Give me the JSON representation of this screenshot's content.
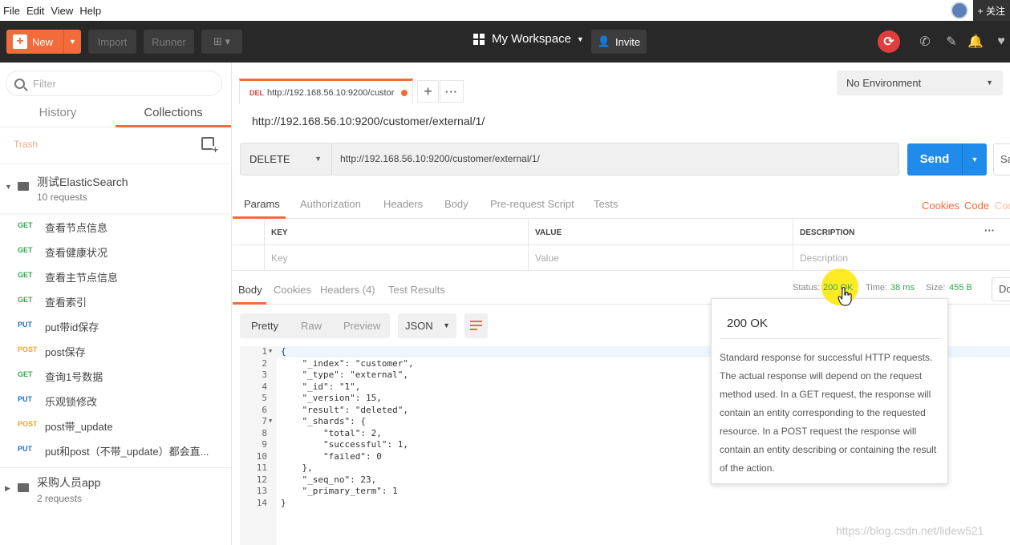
{
  "menubar": {
    "items": [
      "File",
      "Edit",
      "View",
      "Help"
    ],
    "follow_label": "+ 关注"
  },
  "header": {
    "new_label": "New",
    "import_label": "Import",
    "runner_label": "Runner",
    "workspace_label": "My Workspace",
    "invite_label": "Invite",
    "accent_color": "#f26b3a"
  },
  "sidebar": {
    "filter_placeholder": "Filter",
    "tabs": [
      "History",
      "Collections"
    ],
    "active_tab": "Collections",
    "trash_label": "Trash",
    "collections": [
      {
        "name": "测试ElasticSearch",
        "count": "10 requests",
        "expanded": true
      },
      {
        "name": "采购人员app",
        "count": "2 requests",
        "expanded": false
      }
    ],
    "requests": [
      {
        "method": "GET",
        "name": "查看节点信息"
      },
      {
        "method": "GET",
        "name": "查看健康状况"
      },
      {
        "method": "GET",
        "name": "查看主节点信息"
      },
      {
        "method": "GET",
        "name": "查看索引"
      },
      {
        "method": "PUT",
        "name": "put带id保存"
      },
      {
        "method": "POST",
        "name": "post保存"
      },
      {
        "method": "GET",
        "name": "查询1号数据"
      },
      {
        "method": "PUT",
        "name": "乐观锁修改"
      },
      {
        "method": "POST",
        "name": "post带_update"
      },
      {
        "method": "PUT",
        "name": "put和post（不带_update）都会直..."
      }
    ]
  },
  "tab": {
    "method": "DEL",
    "title": "http://192.168.56.10:9200/custor"
  },
  "environment": "No Environment",
  "request": {
    "name": "http://192.168.56.10:9200/customer/external/1/",
    "method": "DELETE",
    "url": "http://192.168.56.10:9200/customer/external/1/",
    "send_label": "Send",
    "save_label": "Sa",
    "tabs": [
      "Params",
      "Authorization",
      "Headers",
      "Body",
      "Pre-request Script",
      "Tests"
    ],
    "links": [
      "Cookies",
      "Code",
      "Cor"
    ]
  },
  "params_table": {
    "headers": [
      "KEY",
      "VALUE",
      "DESCRIPTION"
    ],
    "placeholders": [
      "Key",
      "Value",
      "Description"
    ]
  },
  "response": {
    "tabs": [
      "Body",
      "Cookies",
      "Headers (4)",
      "Test Results"
    ],
    "status_label": "Status:",
    "status_value": "200 OK",
    "time_label": "Time:",
    "time_value": "38 ms",
    "size_label": "Size:",
    "size_value": "455 B",
    "download_label": "Do",
    "view_tabs": [
      "Pretty",
      "Raw",
      "Preview"
    ],
    "format": "JSON",
    "code_lines": [
      "{",
      "    \"_index\": \"customer\",",
      "    \"_type\": \"external\",",
      "    \"_id\": \"1\",",
      "    \"_version\": 15,",
      "    \"result\": \"deleted\",",
      "    \"_shards\": {",
      "        \"total\": 2,",
      "        \"successful\": 1,",
      "        \"failed\": 0",
      "    },",
      "    \"_seq_no\": 23,",
      "    \"_primary_term\": 1",
      "}"
    ]
  },
  "tooltip": {
    "title": "200 OK",
    "body": "Standard response for successful HTTP requests. The actual response will depend on the request method used. In a GET request, the response will contain an entity corresponding to the requested resource. In a POST request the response will contain an entity describing or containing the result of the action."
  },
  "watermark": "https://blog.csdn.net/lidew521"
}
